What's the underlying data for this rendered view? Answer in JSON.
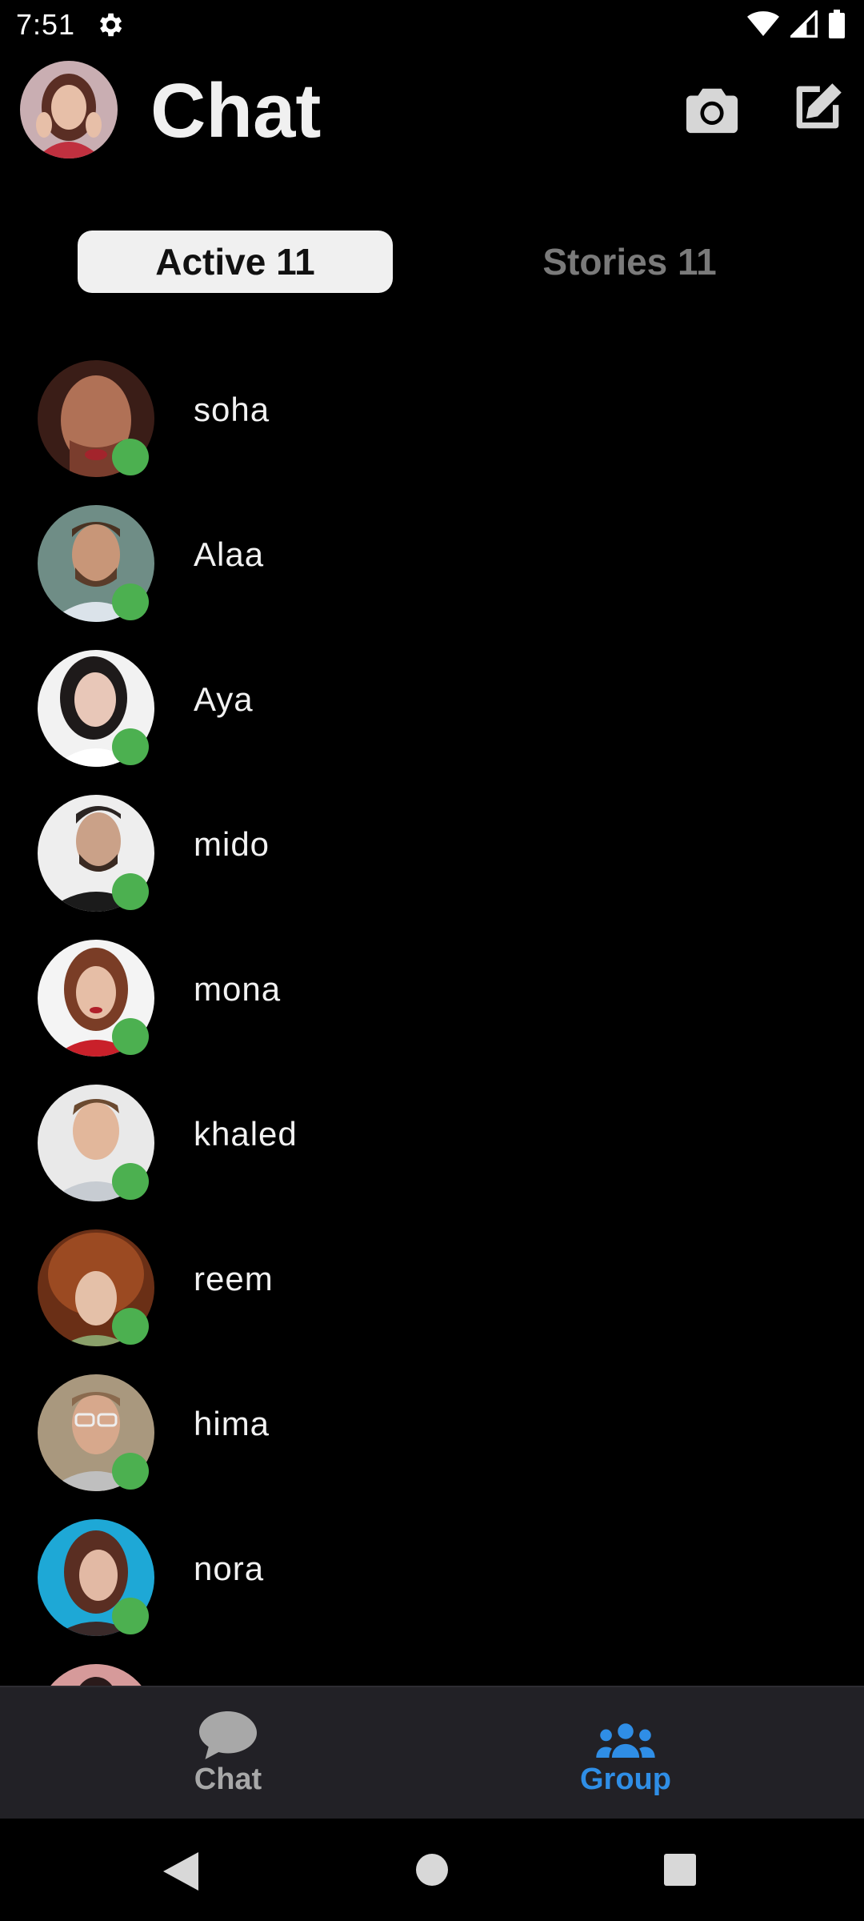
{
  "status_bar": {
    "time": "7:51"
  },
  "header": {
    "title": "Chat"
  },
  "tabs": {
    "active_label": "Active 11",
    "stories_label": "Stories 11"
  },
  "contacts": [
    {
      "name": "soha"
    },
    {
      "name": "Alaa"
    },
    {
      "name": "Aya"
    },
    {
      "name": "mido"
    },
    {
      "name": "mona"
    },
    {
      "name": "khaled"
    },
    {
      "name": "reem"
    },
    {
      "name": "hima"
    },
    {
      "name": "nora"
    }
  ],
  "bottom_nav": {
    "chat_label": "Chat",
    "group_label": "Group"
  },
  "colors": {
    "online": "#4cb050",
    "accent": "#2f8ee6",
    "nav_bg": "#222126"
  }
}
